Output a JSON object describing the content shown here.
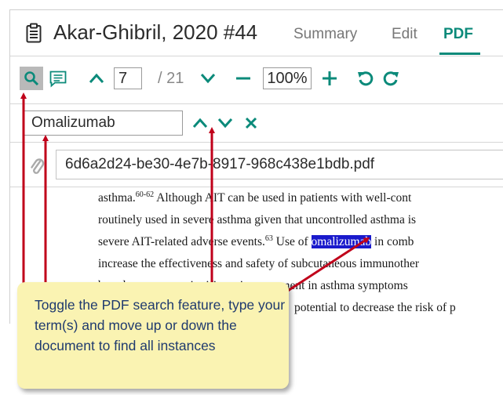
{
  "header": {
    "title": "Akar-Ghibril, 2020 #44",
    "tabs": [
      {
        "label": "Summary",
        "active": false
      },
      {
        "label": "Edit",
        "active": false
      },
      {
        "label": "PDF",
        "active": true
      }
    ]
  },
  "toolbar": {
    "page_current": "7",
    "page_total": "/ 21",
    "zoom": "100%"
  },
  "search": {
    "term": "Omalizumab"
  },
  "file": {
    "name": "6d6a2d24-be30-4e7b-8917-968c438e1bdb.pdf"
  },
  "pdf": {
    "lines": [
      {
        "before": "asthma.",
        "sup": "60-62",
        "after": " Although AIT can be used in patients with well-cont"
      },
      {
        "text": "routinely used in severe asthma given that uncontrolled asthma is"
      },
      {
        "before": "severe AIT-related adverse events.",
        "sup": "63",
        "mid": " Use of ",
        "highlight": "omalizumab",
        "after": " in comb"
      },
      {
        "text": "increase the effectiveness and safety of subcutaneous immunother"
      },
      {
        "text": "based amounts to significant improvement in asthma symptoms"
      },
      {
        "text": "potential to decrease the risk of p"
      }
    ]
  },
  "callout": {
    "text": "Toggle the PDF search feature, type your term(s) and move up or down the document to find all instances"
  },
  "colors": {
    "accent": "#0b8a7a",
    "highlight": "#1a1acc",
    "callout_bg": "#faf3b2",
    "callout_text": "#1f3a6e",
    "arrow": "#c0001a"
  }
}
